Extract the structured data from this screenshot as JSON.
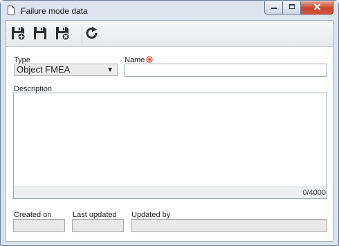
{
  "window": {
    "title": "Failure mode data",
    "icons": {
      "title": "document-icon",
      "minimize": "minimize-icon",
      "maximize": "maximize-icon",
      "close": "close-icon"
    }
  },
  "toolbar": {
    "buttons": [
      {
        "name": "save-and-new-button",
        "icon": "save-plus-icon"
      },
      {
        "name": "save-button",
        "icon": "save-icon"
      },
      {
        "name": "save-and-close-button",
        "icon": "save-close-icon"
      },
      {
        "name": "refresh-button",
        "icon": "refresh-icon"
      }
    ]
  },
  "form": {
    "type": {
      "label": "Type",
      "value": "Object FMEA"
    },
    "name": {
      "label": "Name",
      "value": "",
      "required": true
    },
    "description": {
      "label": "Description",
      "value": "",
      "counter": "0/4000"
    },
    "created_on": {
      "label": "Created on",
      "value": ""
    },
    "last_updated": {
      "label": "Last updated",
      "value": ""
    },
    "updated_by": {
      "label": "Updated by",
      "value": ""
    }
  },
  "colors": {
    "close_button": "#c8432b",
    "required_marker": "#d8312a",
    "window_frame": "#dce3ec"
  }
}
